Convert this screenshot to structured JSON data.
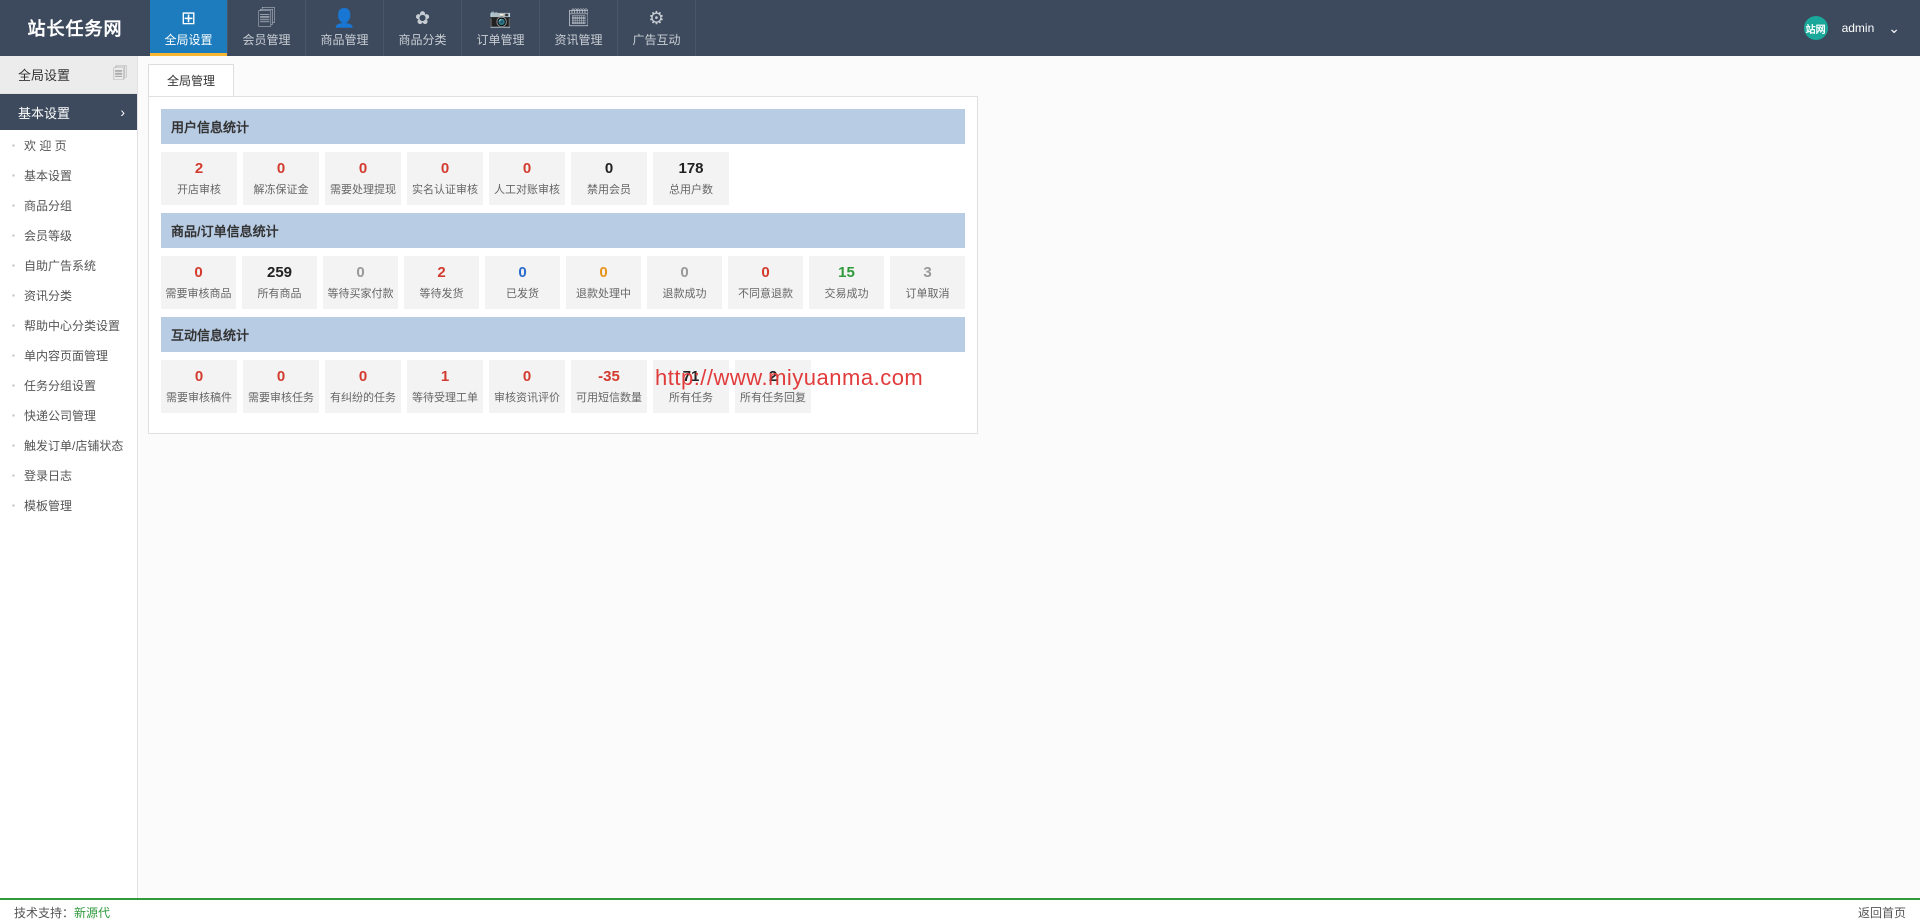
{
  "logo": "站长任务网",
  "nav": [
    {
      "label": "全局设置",
      "icon": "⊞"
    },
    {
      "label": "会员管理",
      "icon": "🗐"
    },
    {
      "label": "商品管理",
      "icon": "👤"
    },
    {
      "label": "商品分类",
      "icon": "✿"
    },
    {
      "label": "订单管理",
      "icon": "📷"
    },
    {
      "label": "资讯管理",
      "icon": "🗓"
    },
    {
      "label": "广告互动",
      "icon": "⚙"
    }
  ],
  "user": {
    "name": "admin",
    "badge": "站网"
  },
  "sidebar": {
    "header": "全局设置",
    "group": "基本设置",
    "items": [
      "欢 迎 页",
      "基本设置",
      "商品分组",
      "会员等级",
      "自助广告系统",
      "资讯分类",
      "帮助中心分类设置",
      "单内容页面管理",
      "任务分组设置",
      "快递公司管理",
      "触发订单/店铺状态",
      "登录日志",
      "模板管理"
    ]
  },
  "tab": "全局管理",
  "sections": [
    {
      "title": "用户信息统计",
      "cards": [
        {
          "num": "2",
          "label": "开店审核",
          "color": "c-red"
        },
        {
          "num": "0",
          "label": "解冻保证金",
          "color": "c-red"
        },
        {
          "num": "0",
          "label": "需要处理提现",
          "color": "c-red"
        },
        {
          "num": "0",
          "label": "实名认证审核",
          "color": "c-red"
        },
        {
          "num": "0",
          "label": "人工对账审核",
          "color": "c-red"
        },
        {
          "num": "0",
          "label": "禁用会员",
          "color": "c-black"
        },
        {
          "num": "178",
          "label": "总用户数",
          "color": "c-black"
        }
      ]
    },
    {
      "title": "商品/订单信息统计",
      "cards": [
        {
          "num": "0",
          "label": "需要审核商品",
          "color": "c-red"
        },
        {
          "num": "259",
          "label": "所有商品",
          "color": "c-black"
        },
        {
          "num": "0",
          "label": "等待买家付款",
          "color": "c-gray"
        },
        {
          "num": "2",
          "label": "等待发货",
          "color": "c-red"
        },
        {
          "num": "0",
          "label": "已发货",
          "color": "c-blue"
        },
        {
          "num": "0",
          "label": "退款处理中",
          "color": "c-orange"
        },
        {
          "num": "0",
          "label": "退款成功",
          "color": "c-gray"
        },
        {
          "num": "0",
          "label": "不同意退款",
          "color": "c-red"
        },
        {
          "num": "15",
          "label": "交易成功",
          "color": "c-green"
        },
        {
          "num": "3",
          "label": "订单取消",
          "color": "c-gray"
        }
      ]
    },
    {
      "title": "互动信息统计",
      "cards": [
        {
          "num": "0",
          "label": "需要审核稿件",
          "color": "c-red"
        },
        {
          "num": "0",
          "label": "需要审核任务",
          "color": "c-red"
        },
        {
          "num": "0",
          "label": "有纠纷的任务",
          "color": "c-red"
        },
        {
          "num": "1",
          "label": "等待受理工单",
          "color": "c-red"
        },
        {
          "num": "0",
          "label": "审核资讯评价",
          "color": "c-red"
        },
        {
          "num": "-35",
          "label": "可用短信数量",
          "color": "c-red"
        },
        {
          "num": "71",
          "label": "所有任务",
          "color": "c-black"
        },
        {
          "num": "2",
          "label": "所有任务回复",
          "color": "c-black"
        }
      ]
    }
  ],
  "watermark": "http://www.miyuanma.com",
  "footer": {
    "support_label": "技术支持：",
    "support_link": "新源代",
    "return": "返回首页"
  }
}
